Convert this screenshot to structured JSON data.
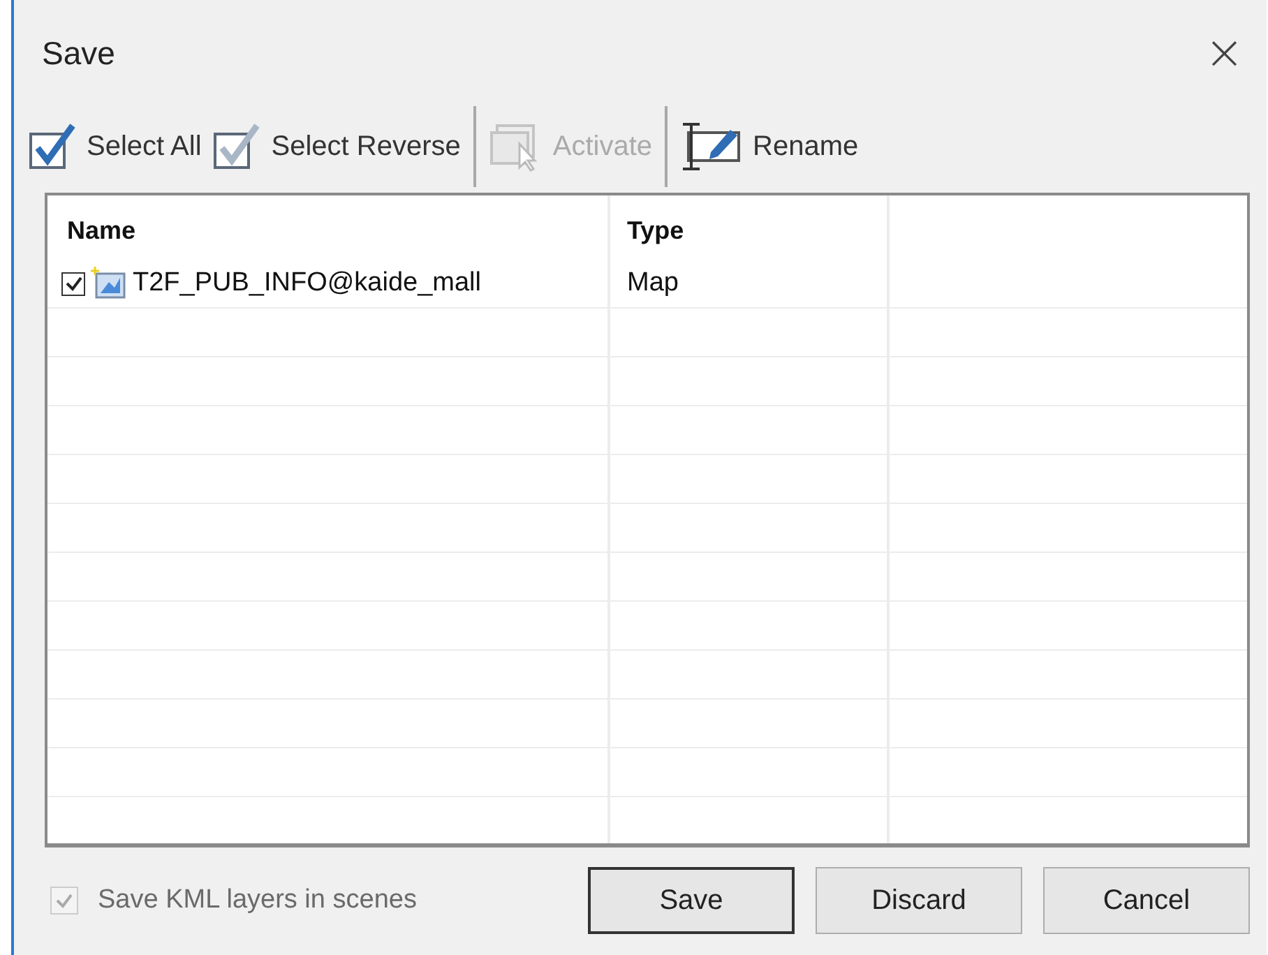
{
  "window": {
    "title": "Save",
    "close": "×"
  },
  "toolbar": [
    {
      "kind": "button",
      "label": "Select All",
      "disabled": false
    },
    {
      "kind": "button",
      "label": "Select Reverse",
      "disabled": false
    },
    {
      "kind": "separator"
    },
    {
      "kind": "button",
      "label": "Activate",
      "disabled": true
    },
    {
      "kind": "separator"
    },
    {
      "kind": "button",
      "label": "Rename",
      "disabled": false
    }
  ],
  "table": {
    "columns": [
      "Name",
      "Type"
    ],
    "rows": [
      {
        "name": "T2F_PUB_INFO@kaide_mall",
        "type": "Map",
        "checked": true
      }
    ]
  },
  "footer": {
    "option": {
      "label": "Save KML layers in scenes",
      "checked": true,
      "disabled": true
    },
    "buttons": [
      {
        "label": "Save",
        "default": true
      },
      {
        "label": "Discard",
        "default": false
      },
      {
        "label": "Cancel",
        "default": false
      }
    ]
  }
}
